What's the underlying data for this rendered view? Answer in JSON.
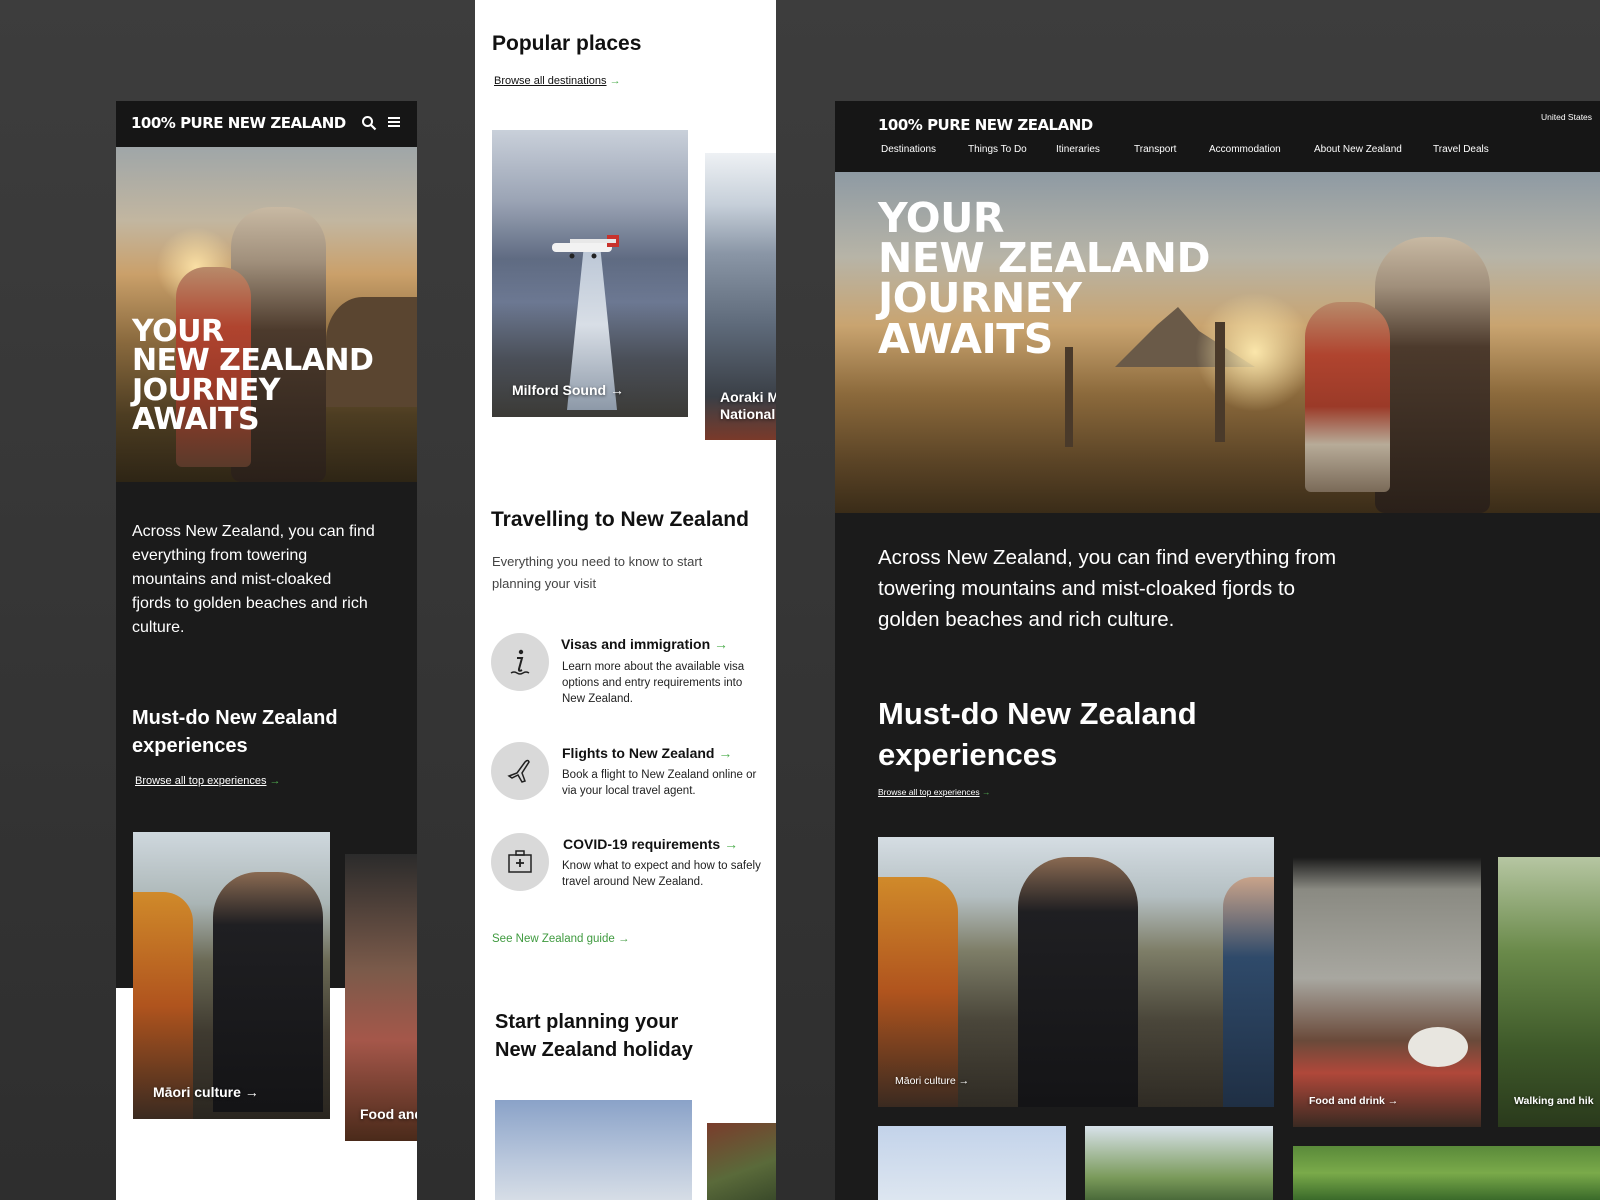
{
  "brand": {
    "logo_text": "100% PURE NEW ZEALAND"
  },
  "hero": {
    "title_lines": [
      "Your",
      "New Zealand",
      "Journey",
      "Awaits"
    ]
  },
  "intro": {
    "text": "Across New Zealand, you can find everything from towering mountains and mist-cloaked fjords to golden beaches and rich culture.",
    "mobile_lines": [
      "Across New Zealand, you can find",
      "everything from towering",
      "mountains and mist-cloaked",
      "fjords to golden beaches and rich",
      "culture."
    ],
    "desktop_lines": [
      "Across New Zealand, you can find everything from",
      "towering mountains and mist-cloaked fjords to",
      "golden beaches and rich culture."
    ]
  },
  "must_do": {
    "title_lines": [
      "Must-do New Zealand",
      "experiences"
    ],
    "browse_label": "Browse all top experiences",
    "cards": [
      "Māori culture",
      "Food and drink",
      "Walking and hiking"
    ],
    "mobile_partial_label": "Food and",
    "desktop_partial_label": "Walking and hik"
  },
  "popular": {
    "title": "Popular places",
    "browse_label": "Browse all destinations",
    "cards": [
      "Milford Sound",
      "Aoraki Mount Cook National Park"
    ],
    "partial_lines": [
      "Aoraki M",
      "National"
    ]
  },
  "travelling": {
    "title": "Travelling to New Zealand",
    "subtitle_lines": [
      "Everything you need to know to start",
      "planning your visit"
    ],
    "items": [
      {
        "title": "Visas and immigration",
        "desc_lines": [
          "Learn more about the available visa",
          "options and entry requirements into",
          "New Zealand."
        ],
        "icon": "info-icon"
      },
      {
        "title": "Flights to New Zealand",
        "desc_lines": [
          "Book a flight to New Zealand online or",
          "via your local travel agent."
        ],
        "icon": "plane-icon"
      },
      {
        "title": "COVID-19 requirements",
        "desc_lines": [
          "Know what to expect and how to safely",
          "travel around New Zealand."
        ],
        "icon": "first-aid-kit-icon"
      }
    ],
    "guide_link": "See New Zealand guide"
  },
  "planning": {
    "title_lines": [
      "Start planning your",
      "New Zealand holiday"
    ]
  },
  "desktop_nav": {
    "items": [
      "Destinations",
      "Things To Do",
      "Itineraries",
      "Transport",
      "Accommodation",
      "About New Zealand",
      "Travel Deals"
    ],
    "region": "United States"
  },
  "colors": {
    "dark_bg": "#1b1b1b",
    "accent_green": "#3f9a3f",
    "page_bg": "#353535"
  }
}
